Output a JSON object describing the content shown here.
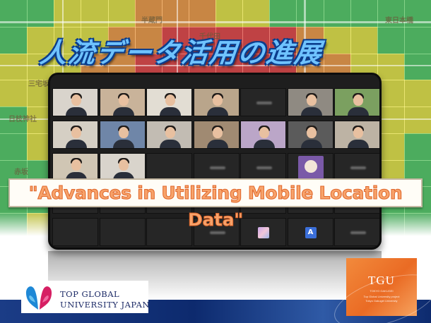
{
  "title_jp": "人流データ活用の進展",
  "banner_text": "\"Advances in Utilizing Mobile Location Data\"",
  "map_labels": [
    "千代田",
    "日枝神社",
    "三宅坂",
    "半蔵門",
    "赤坂",
    "東日本橋"
  ],
  "tile_initials": [
    "A",
    "A"
  ],
  "logo_tgj": {
    "line1": "TOP GLOBAL",
    "line2": "UNIVERSITY JAPAN"
  },
  "logo_tgu": {
    "text": "TGU",
    "small1": "TOKYO GAKUGEI",
    "small2": "Top Global University project",
    "small3": "Tokyo Gakugei University"
  },
  "colors": {
    "title_fill": "#6fc3ff",
    "title_outline": "#0b3d8c",
    "banner_text": "#f7a36b",
    "banner_stroke": "#e0662a",
    "tgu_orange": "#ea6b24",
    "tablet": "#1e1e1e",
    "heat_red": "#e8473a",
    "heat_orange": "#f39a3a",
    "heat_yellow": "#e8e23a",
    "heat_green": "#5cc85a"
  }
}
